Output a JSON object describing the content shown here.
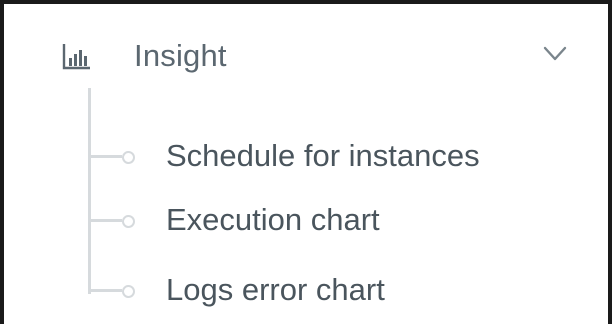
{
  "menu": {
    "section_label": "Insight",
    "section_icon": "bar-chart-icon",
    "expand_icon": "chevron-down-icon",
    "expanded": true,
    "items": [
      {
        "label": "Schedule for instances"
      },
      {
        "label": "Execution chart"
      },
      {
        "label": "Logs error chart"
      }
    ]
  },
  "colors": {
    "text": "#4a555d",
    "tree_line": "#d6dadd"
  }
}
